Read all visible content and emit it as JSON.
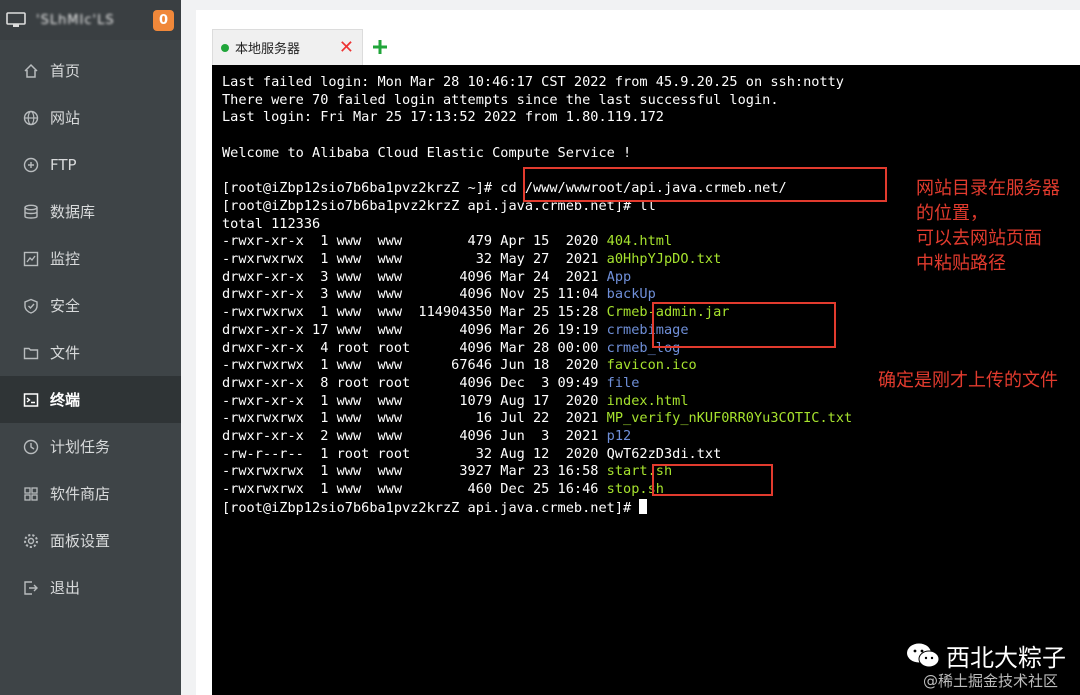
{
  "sidebar": {
    "hostname": "'SLhMIc'LS",
    "badge_count": "0",
    "items": [
      {
        "label": "首页",
        "icon": "home-icon"
      },
      {
        "label": "网站",
        "icon": "globe-icon"
      },
      {
        "label": "FTP",
        "icon": "ftp-icon"
      },
      {
        "label": "数据库",
        "icon": "database-icon"
      },
      {
        "label": "监控",
        "icon": "monitor-icon"
      },
      {
        "label": "安全",
        "icon": "shield-icon"
      },
      {
        "label": "文件",
        "icon": "folder-icon"
      },
      {
        "label": "终端",
        "icon": "terminal-icon"
      },
      {
        "label": "计划任务",
        "icon": "clock-icon"
      },
      {
        "label": "软件商店",
        "icon": "apps-icon"
      },
      {
        "label": "面板设置",
        "icon": "gear-icon"
      },
      {
        "label": "退出",
        "icon": "logout-icon"
      }
    ],
    "active_item": "终端"
  },
  "tabs": [
    {
      "label": "本地服务器",
      "status": "connected"
    }
  ],
  "colors": {
    "accent": "#20a53a",
    "badge": "#f0883a",
    "annotation": "#e23b2e",
    "file_green": "#a6e22e",
    "dir_blue": "#6f8fd8"
  },
  "terminal": {
    "header": [
      "Last failed login: Mon Mar 28 10:46:17 CST 2022 from 45.9.20.25 on ssh:notty",
      "There were 70 failed login attempts since the last successful login.",
      "Last login: Fri Mar 25 17:13:52 2022 from 1.80.119.172",
      "",
      "Welcome to Alibaba Cloud Elastic Compute Service !",
      "",
      "[root@iZbp12sio7b6ba1pvz2krzZ ~]# cd /www/wwwroot/api.java.crmeb.net/",
      "[root@iZbp12sio7b6ba1pvz2krzZ api.java.crmeb.net]# ll",
      "total 112336"
    ],
    "files": [
      {
        "meta": "-rwxr-xr-x  1 www  www        479 Apr 15  2020",
        "name": "404.html",
        "color": "g"
      },
      {
        "meta": "-rwxrwxrwx  1 www  www         32 May 27  2021",
        "name": "a0HhpYJpDO.txt",
        "color": "g"
      },
      {
        "meta": "drwxr-xr-x  3 www  www       4096 Mar 24  2021",
        "name": "App",
        "color": "b"
      },
      {
        "meta": "drwxr-xr-x  3 www  www       4096 Nov 25 11:04",
        "name": "backUp",
        "color": "b"
      },
      {
        "meta": "-rwxrwxrwx  1 www  www  114904350 Mar 25 15:28",
        "name": "Crmeb-admin.jar",
        "color": "g"
      },
      {
        "meta": "drwxr-xr-x 17 www  www       4096 Mar 26 19:19",
        "name": "crmebimage",
        "color": "b"
      },
      {
        "meta": "drwxr-xr-x  4 root root      4096 Mar 28 00:00",
        "name": "crmeb_log",
        "color": "b"
      },
      {
        "meta": "-rwxrwxrwx  1 www  www      67646 Jun 18  2020",
        "name": "favicon.ico",
        "color": "g"
      },
      {
        "meta": "drwxr-xr-x  8 root root      4096 Dec  3 09:49",
        "name": "file",
        "color": "b"
      },
      {
        "meta": "-rwxr-xr-x  1 www  www       1079 Aug 17  2020",
        "name": "index.html",
        "color": "g"
      },
      {
        "meta": "-rwxrwxrwx  1 www  www         16 Jul 22  2021",
        "name": "MP_verify_nKUF0RR0Yu3COTIC.txt",
        "color": "g"
      },
      {
        "meta": "drwxr-xr-x  2 www  www       4096 Jun  3  2021",
        "name": "p12",
        "color": "b"
      },
      {
        "meta": "-rw-r--r--  1 root root        32 Aug 12  2020",
        "name": "QwT62zD3di.txt",
        "color": "w"
      },
      {
        "meta": "-rwxrwxrwx  1 www  www       3927 Mar 23 16:58",
        "name": "start.sh",
        "color": "g"
      },
      {
        "meta": "-rwxrwxrwx  1 www  www        460 Dec 25 16:46",
        "name": "stop.sh",
        "color": "g"
      }
    ],
    "prompt": "[root@iZbp12sio7b6ba1pvz2krzZ api.java.crmeb.net]# "
  },
  "annotations": {
    "path_note": "网站目录在服务器\n的位置，\n可以去网站页面\n中粘贴路径",
    "files_note": "确定是刚才上传的文件"
  },
  "watermark": {
    "name": "西北大粽子",
    "sub": "@稀土掘金技术社区"
  }
}
